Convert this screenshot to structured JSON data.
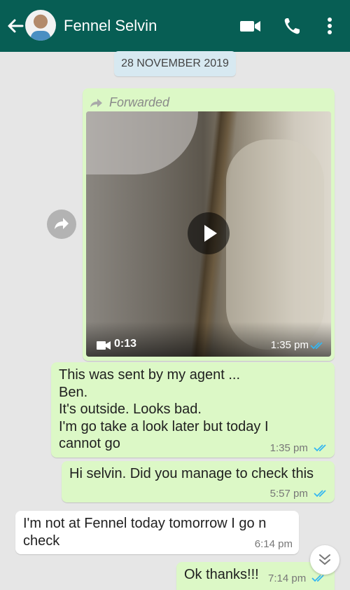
{
  "header": {
    "contact_name": "Fennel Selvin",
    "colors": {
      "bar": "#075e54",
      "bubble_out": "#dcf8c6",
      "bubble_in": "#ffffff",
      "tick_read": "#34b7f1"
    },
    "icons": [
      "back-arrow-icon",
      "avatar",
      "video-call-icon",
      "phone-icon",
      "more-options-icon"
    ]
  },
  "date_chip": "28 NOVEMBER 2019",
  "messages": [
    {
      "forwarded_label": "Forwarded",
      "video_duration": "0:13",
      "time": "1:35 pm"
    },
    {
      "text": "This was sent by my agent ...\nBen.\nIt's outside. Looks bad.\nI'm go take a look later but today I\ncannot go",
      "time": "1:35 pm"
    },
    {
      "text": "Hi selvin. Did you manage to check this",
      "time": "5:57 pm"
    },
    {
      "text": "I'm not at Fennel today tomorrow I go n\ncheck",
      "time": "6:14 pm"
    },
    {
      "text": "Ok thanks!!!",
      "time": "7:14 pm"
    }
  ]
}
